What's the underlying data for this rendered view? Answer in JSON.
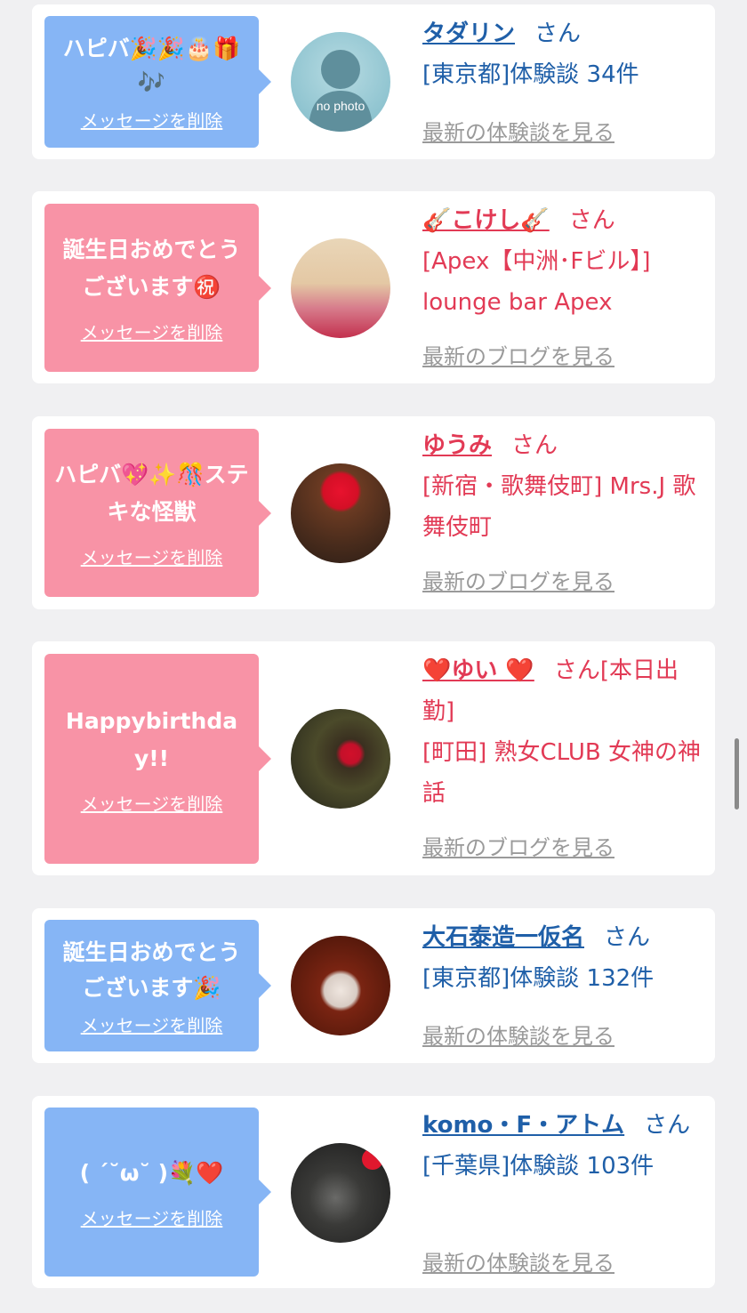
{
  "delete_label": "メッセージを削除",
  "san": "さん",
  "cards": [
    {
      "color": "blue",
      "message": "ハピバ🎉🎉🎂🎁🎶",
      "name": "タダリン",
      "details": [
        "[東京都]体験談 34件"
      ],
      "latest": "最新の体験談を見る",
      "avatar_text": "no photo"
    },
    {
      "color": "pink",
      "message": "誕生日おめでとうございます㊗️",
      "name": "🎸こけし🎸",
      "details": [
        "[Apex【中洲･Fビル】] lounge bar Apex"
      ],
      "latest": "最新のブログを見る"
    },
    {
      "color": "pink",
      "message": "ハピバ💖✨🎊ステキな怪獣",
      "name": "ゆうみ",
      "details": [
        "[新宿・歌舞伎町] Mrs.J 歌舞伎町"
      ],
      "latest": "最新のブログを見る"
    },
    {
      "color": "pink",
      "message": "Happybirthday!!",
      "name": "❤️ゆい ❤️",
      "name_suffix": "[本日出勤]",
      "details": [
        "[町田] 熟女CLUB 女神の神話"
      ],
      "latest": "最新のブログを見る"
    },
    {
      "color": "blue",
      "message": "誕生日おめでとうございます🎉",
      "name": "大石泰造一仮名",
      "details": [
        "[東京都]体験談 132件"
      ],
      "latest": "最新の体験談を見る"
    },
    {
      "color": "blue",
      "message": "( ´˘ω˘ )💐❤️",
      "name": "komo・F・アトム",
      "details": [
        "[千葉県]体験談 103件"
      ],
      "latest": "最新の体験談を見る"
    }
  ]
}
